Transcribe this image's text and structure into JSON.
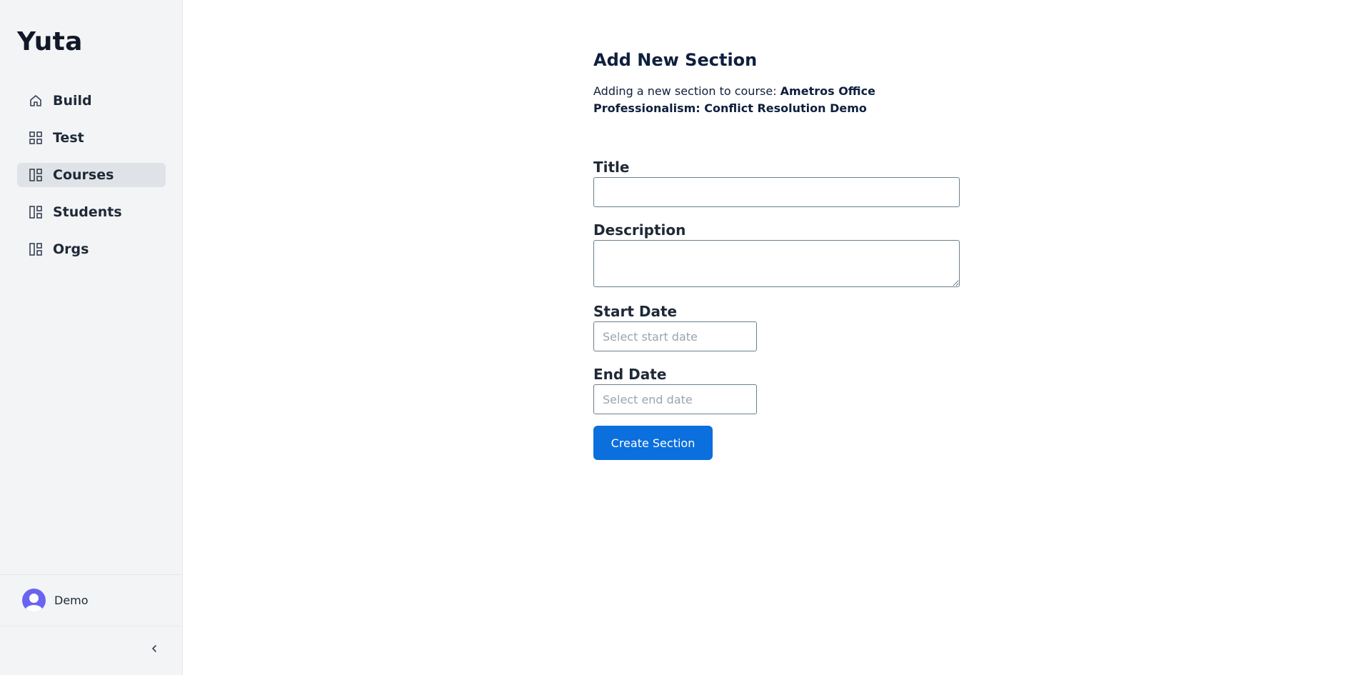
{
  "sidebar": {
    "brand": "Yuta",
    "items": [
      {
        "label": "Build",
        "icon": "home-icon"
      },
      {
        "label": "Test",
        "icon": "grid-icon"
      },
      {
        "label": "Courses",
        "icon": "layout-icon",
        "active": true
      },
      {
        "label": "Students",
        "icon": "layout-icon"
      },
      {
        "label": "Orgs",
        "icon": "layout-icon"
      }
    ],
    "user": {
      "name": "Demo",
      "avatar_color": "#6b64f0"
    }
  },
  "form": {
    "title": "Add New Section",
    "subtitle_prefix": "Adding a new section to course: ",
    "course_name": "Ametros Office Professionalism: Conflict Resolution Demo",
    "fields": {
      "title": {
        "label": "Title",
        "value": ""
      },
      "description": {
        "label": "Description",
        "value": ""
      },
      "start_date": {
        "label": "Start Date",
        "placeholder": "Select start date",
        "value": ""
      },
      "end_date": {
        "label": "End Date",
        "placeholder": "Select end date",
        "value": ""
      }
    },
    "submit_label": "Create Section"
  },
  "colors": {
    "accent": "#0b6fdd",
    "sidebar_bg": "#f3f4f6",
    "active_item_bg": "#dfe3e7"
  }
}
